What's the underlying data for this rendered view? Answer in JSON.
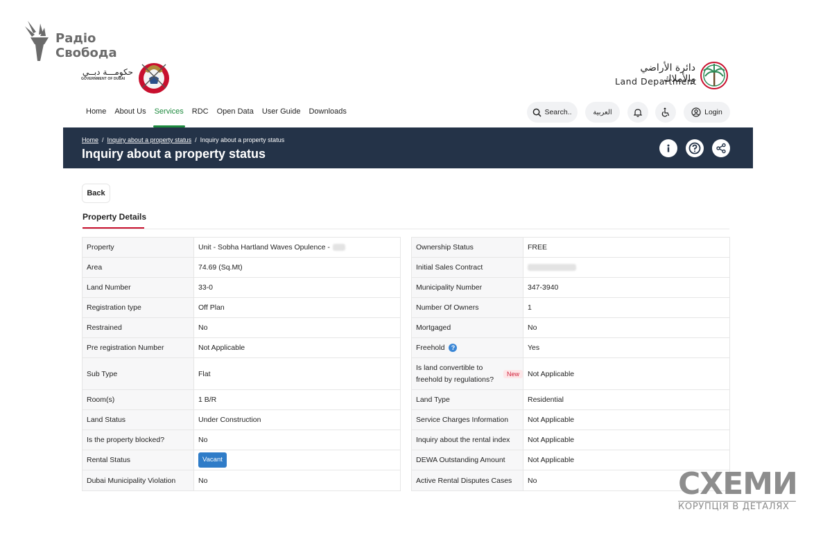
{
  "branding": {
    "radio_svoboda": [
      "Радіо",
      "Свобода"
    ],
    "gov_dubai_ar": "حكومـــة دبــي",
    "gov_dubai_en": "GOVERNMENT OF DUBAI",
    "land_dept_ar": "دائرة الأراضي والأملاك",
    "land_dept_en": "Land Department",
    "watermark_title": "СХЕМИ",
    "watermark_subtitle": "КОРУПЦІЯ В ДЕТАЛЯХ"
  },
  "nav": {
    "items": [
      "Home",
      "About Us",
      "Services",
      "RDC",
      "Open Data",
      "User Guide",
      "Downloads"
    ],
    "active": "Services"
  },
  "toolbar": {
    "search_label": "Search..",
    "arabic_label": "العربية",
    "login_label": "Login"
  },
  "banner": {
    "breadcrumb": [
      "Home",
      "Inquiry about a property status",
      "Inquiry about a property status"
    ],
    "title": "Inquiry about a property status",
    "bg_color": "#243348"
  },
  "back_label": "Back",
  "section_title": "Property Details",
  "left_table": [
    {
      "label": "Property",
      "value": "Unit - Sobha Hartland Waves Opulence -"
    },
    {
      "label": "Area",
      "value": "74.69 (Sq.Mt)"
    },
    {
      "label": "Land Number",
      "value": "33-0"
    },
    {
      "label": "Registration type",
      "value": "Off Plan"
    },
    {
      "label": "Restrained",
      "value": "No"
    },
    {
      "label": "Pre registration Number",
      "value": "Not Applicable"
    },
    {
      "label": "Sub Type",
      "value": "Flat"
    },
    {
      "label": "Room(s)",
      "value": "1 B/R"
    },
    {
      "label": "Land Status",
      "value": "Under Construction"
    },
    {
      "label": "Is the property blocked?",
      "value": "No"
    },
    {
      "label": "Rental Status",
      "value": "Vacant"
    },
    {
      "label": "Dubai Municipality Violation",
      "value": "No"
    }
  ],
  "right_table": [
    {
      "label": "Ownership Status",
      "value": "FREE"
    },
    {
      "label": "Initial Sales Contract",
      "value": ""
    },
    {
      "label": "Municipality Number",
      "value": "347-3940"
    },
    {
      "label": "Number Of Owners",
      "value": "1"
    },
    {
      "label": "Mortgaged",
      "value": "No"
    },
    {
      "label": "Freehold",
      "value": "Yes"
    },
    {
      "label": "Is land convertible to freehold by regulations?",
      "value": "Not Applicable",
      "badge": "New"
    },
    {
      "label": "Land Type",
      "value": "Residential"
    },
    {
      "label": "Service Charges Information",
      "value": "Not Applicable"
    },
    {
      "label": "Inquiry about the rental index",
      "value": "Not Applicable"
    },
    {
      "label": "DEWA Outstanding Amount",
      "value": "Not Applicable"
    },
    {
      "label": "Active Rental Disputes Cases",
      "value": "No"
    }
  ],
  "colors": {
    "accent_green": "#1d8a3e",
    "accent_red": "#c8102e",
    "vacant_blue": "#2f7cc8"
  }
}
